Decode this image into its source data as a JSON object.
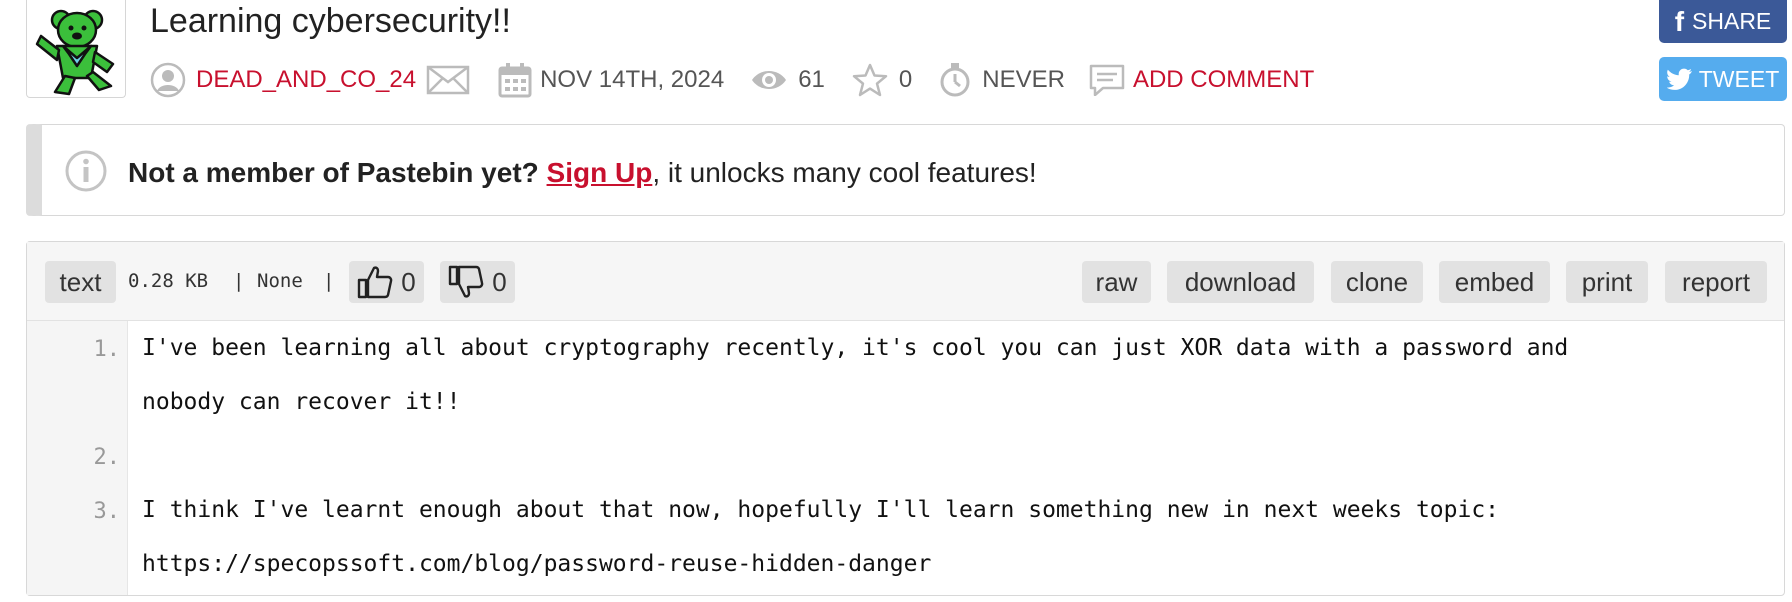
{
  "paste": {
    "title": "Learning cybersecurity!!",
    "author": "DEAD_AND_CO_24",
    "date": "NOV 14TH, 2024",
    "views": "61",
    "stars": "0",
    "expiry": "NEVER",
    "add_comment": "ADD COMMENT"
  },
  "social": {
    "share_label": "SHARE",
    "tweet_label": "TWEET"
  },
  "notice": {
    "bold_text": "Not a member of Pastebin yet?",
    "link_text": "Sign Up",
    "rest_text": ", it unlocks many cool features!"
  },
  "toolbar": {
    "syntax": "text",
    "size": "0.28 KB",
    "separator1": "|",
    "category": "None",
    "separator2": "|",
    "likes": "0",
    "dislikes": "0",
    "buttons": [
      "raw",
      "download",
      "clone",
      "embed",
      "print",
      "report"
    ]
  },
  "code": {
    "line_numbers": [
      "1.",
      "2.",
      "3."
    ],
    "lines": [
      "I've been learning all about cryptography recently, it's cool you can just XOR data with a password and",
      "nobody can recover it!!",
      "",
      "I think I've learnt enough about that now, hopefully I'll learn something new in next weeks topic:",
      "https://specopssoft.com/blog/password-reuse-hidden-danger"
    ]
  },
  "colors": {
    "accent": "#c8102e",
    "facebook": "#3b5998",
    "twitter": "#55acee"
  }
}
